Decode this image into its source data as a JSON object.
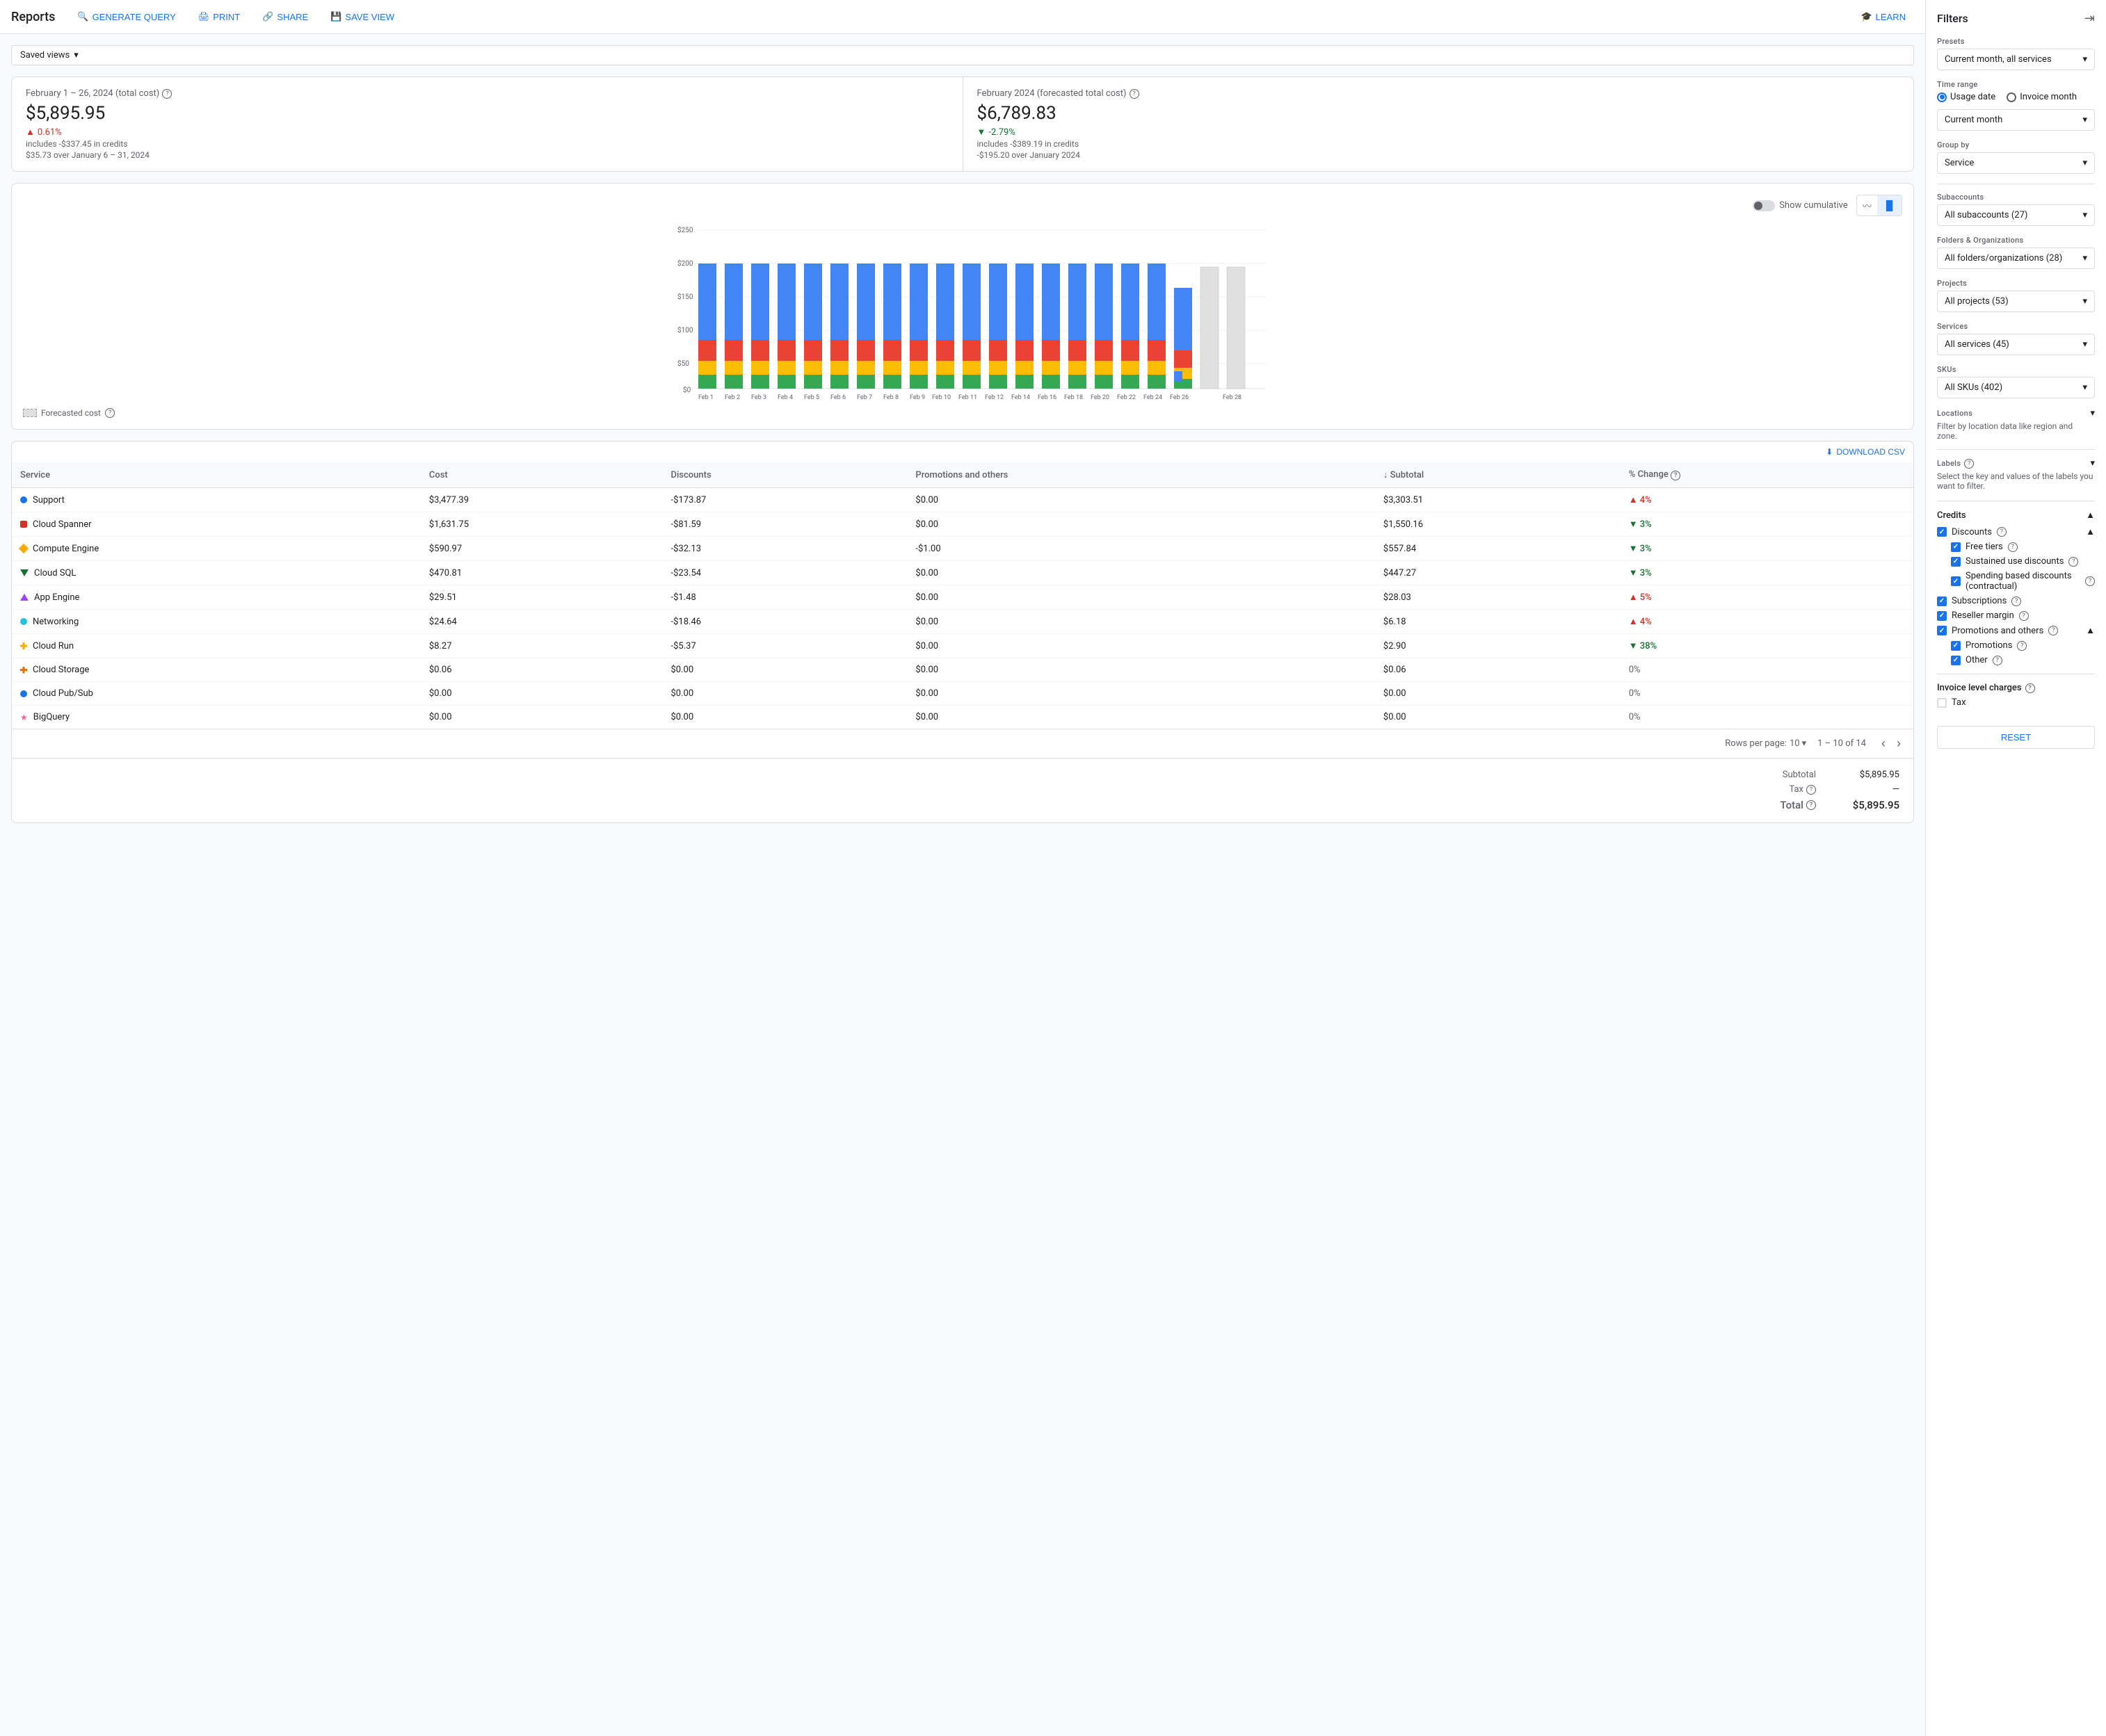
{
  "topbar": {
    "title": "Reports",
    "buttons": [
      {
        "label": "GENERATE QUERY",
        "icon": "🔍"
      },
      {
        "label": "PRINT",
        "icon": "🖨"
      },
      {
        "label": "SHARE",
        "icon": "🔗"
      },
      {
        "label": "SAVE VIEW",
        "icon": "💾"
      },
      {
        "label": "LEARN",
        "icon": "🎓"
      }
    ]
  },
  "savedViews": {
    "label": "Saved views"
  },
  "metrics": [
    {
      "label": "February 1 – 26, 2024 (total cost)",
      "value": "$5,895.95",
      "sub": "includes -$337.45 in credits",
      "changeVal": "0.61%",
      "changeDir": "up",
      "changeSub": "$35.73 over January 6 – 31, 2024"
    },
    {
      "label": "February 2024 (forecasted total cost)",
      "value": "$6,789.83",
      "sub": "includes -$389.19 in credits",
      "changeVal": "-2.79%",
      "changeDir": "down",
      "changeSub": "-$195.20 over January 2024"
    }
  ],
  "chart": {
    "yLabels": [
      "$250",
      "$200",
      "$150",
      "$100",
      "$50",
      "$0"
    ],
    "xLabels": [
      "Feb 1",
      "Feb 2",
      "Feb 3",
      "Feb 4",
      "Feb 5",
      "Feb 6",
      "Feb 7",
      "Feb 8",
      "Feb 9",
      "Feb 10",
      "Feb 11",
      "Feb 12",
      "Feb 14",
      "Feb 16",
      "Feb 18",
      "Feb 20",
      "Feb 22",
      "Feb 24",
      "Feb 26",
      "Feb 28"
    ],
    "showCumulative": "Show cumulative",
    "forecastedLabel": "Forecasted cost"
  },
  "table": {
    "downloadLabel": "DOWNLOAD CSV",
    "columns": [
      "Service",
      "Cost",
      "Discounts",
      "Promotions and others",
      "↓ Subtotal",
      "% Change"
    ],
    "rows": [
      {
        "service": "Support",
        "color": "#1a73e8",
        "shape": "circle",
        "cost": "$3,477.39",
        "discounts": "-$173.87",
        "promos": "$0.00",
        "subtotal": "$3,303.51",
        "pct": "4%",
        "pctDir": "up"
      },
      {
        "service": "Cloud Spanner",
        "color": "#d93025",
        "shape": "square",
        "cost": "$1,631.75",
        "discounts": "-$81.59",
        "promos": "$0.00",
        "subtotal": "$1,550.16",
        "pct": "3%",
        "pctDir": "down"
      },
      {
        "service": "Compute Engine",
        "color": "#f9ab00",
        "shape": "diamond",
        "cost": "$590.97",
        "discounts": "-$32.13",
        "promos": "-$1.00",
        "subtotal": "$557.84",
        "pct": "3%",
        "pctDir": "down"
      },
      {
        "service": "Cloud SQL",
        "color": "#137333",
        "shape": "triangle-down",
        "cost": "$470.81",
        "discounts": "-$23.54",
        "promos": "$0.00",
        "subtotal": "$447.27",
        "pct": "3%",
        "pctDir": "down"
      },
      {
        "service": "App Engine",
        "color": "#a142f4",
        "shape": "triangle-up",
        "cost": "$29.51",
        "discounts": "-$1.48",
        "promos": "$0.00",
        "subtotal": "$28.03",
        "pct": "5%",
        "pctDir": "up"
      },
      {
        "service": "Networking",
        "color": "#24c1e0",
        "shape": "circle",
        "cost": "$24.64",
        "discounts": "-$18.46",
        "promos": "$0.00",
        "subtotal": "$6.18",
        "pct": "4%",
        "pctDir": "up"
      },
      {
        "service": "Cloud Run",
        "color": "#f9ab00",
        "shape": "cross",
        "cost": "$8.27",
        "discounts": "-$5.37",
        "promos": "$0.00",
        "subtotal": "$2.90",
        "pct": "38%",
        "pctDir": "down"
      },
      {
        "service": "Cloud Storage",
        "color": "#e8710a",
        "shape": "cross",
        "cost": "$0.06",
        "discounts": "$0.00",
        "promos": "$0.00",
        "subtotal": "$0.06",
        "pct": "0%",
        "pctDir": "neutral"
      },
      {
        "service": "Cloud Pub/Sub",
        "color": "#1a73e8",
        "shape": "circle",
        "cost": "$0.00",
        "discounts": "$0.00",
        "promos": "$0.00",
        "subtotal": "$0.00",
        "pct": "0%",
        "pctDir": "neutral"
      },
      {
        "service": "BigQuery",
        "color": "#f06292",
        "shape": "star",
        "cost": "$0.00",
        "discounts": "$0.00",
        "promos": "$0.00",
        "subtotal": "$0.00",
        "pct": "0%",
        "pctDir": "neutral"
      }
    ],
    "pagination": {
      "rowsPerPage": "10",
      "range": "1 – 10 of 14"
    },
    "totals": {
      "subtotalLabel": "Subtotal",
      "subtotalVal": "$5,895.95",
      "taxLabel": "Tax",
      "taxVal": "—",
      "totalLabel": "Total",
      "totalVal": "$5,895.95"
    }
  },
  "filters": {
    "title": "Filters",
    "presets": {
      "label": "Presets",
      "value": "Current month, all services"
    },
    "timeRange": {
      "label": "Time range",
      "options": [
        "Usage date",
        "Invoice month"
      ],
      "selected": "Usage date",
      "periodLabel": "Current month"
    },
    "groupBy": {
      "label": "Group by",
      "value": "Service"
    },
    "subaccounts": {
      "label": "Subaccounts",
      "value": "All subaccounts (27)"
    },
    "folders": {
      "label": "Folders & Organizations",
      "value": "All folders/organizations (28)"
    },
    "projects": {
      "label": "Projects",
      "value": "All projects (53)"
    },
    "services": {
      "label": "Services",
      "value": "All services (45)"
    },
    "skus": {
      "label": "SKUs",
      "value": "All SKUs (402)"
    },
    "locations": {
      "label": "Locations",
      "hint": "Filter by location data like region and zone."
    },
    "labels": {
      "label": "Labels",
      "hint": "Select the key and values of the labels you want to filter."
    },
    "credits": {
      "label": "Credits",
      "discounts": {
        "label": "Discounts",
        "items": [
          {
            "label": "Free tiers",
            "checked": true
          },
          {
            "label": "Sustained use discounts",
            "checked": true
          },
          {
            "label": "Spending based discounts (contractual)",
            "checked": true
          }
        ]
      },
      "subscriptions": {
        "label": "Subscriptions",
        "checked": true
      },
      "resellerMargin": {
        "label": "Reseller margin",
        "checked": true
      },
      "promotionsAndOthers": {
        "label": "Promotions and others",
        "items": [
          {
            "label": "Promotions",
            "checked": true
          },
          {
            "label": "Other",
            "checked": true
          }
        ]
      }
    },
    "invoiceCharges": {
      "label": "Invoice level charges",
      "tax": {
        "label": "Tax",
        "checked": false
      }
    },
    "resetLabel": "RESET"
  }
}
